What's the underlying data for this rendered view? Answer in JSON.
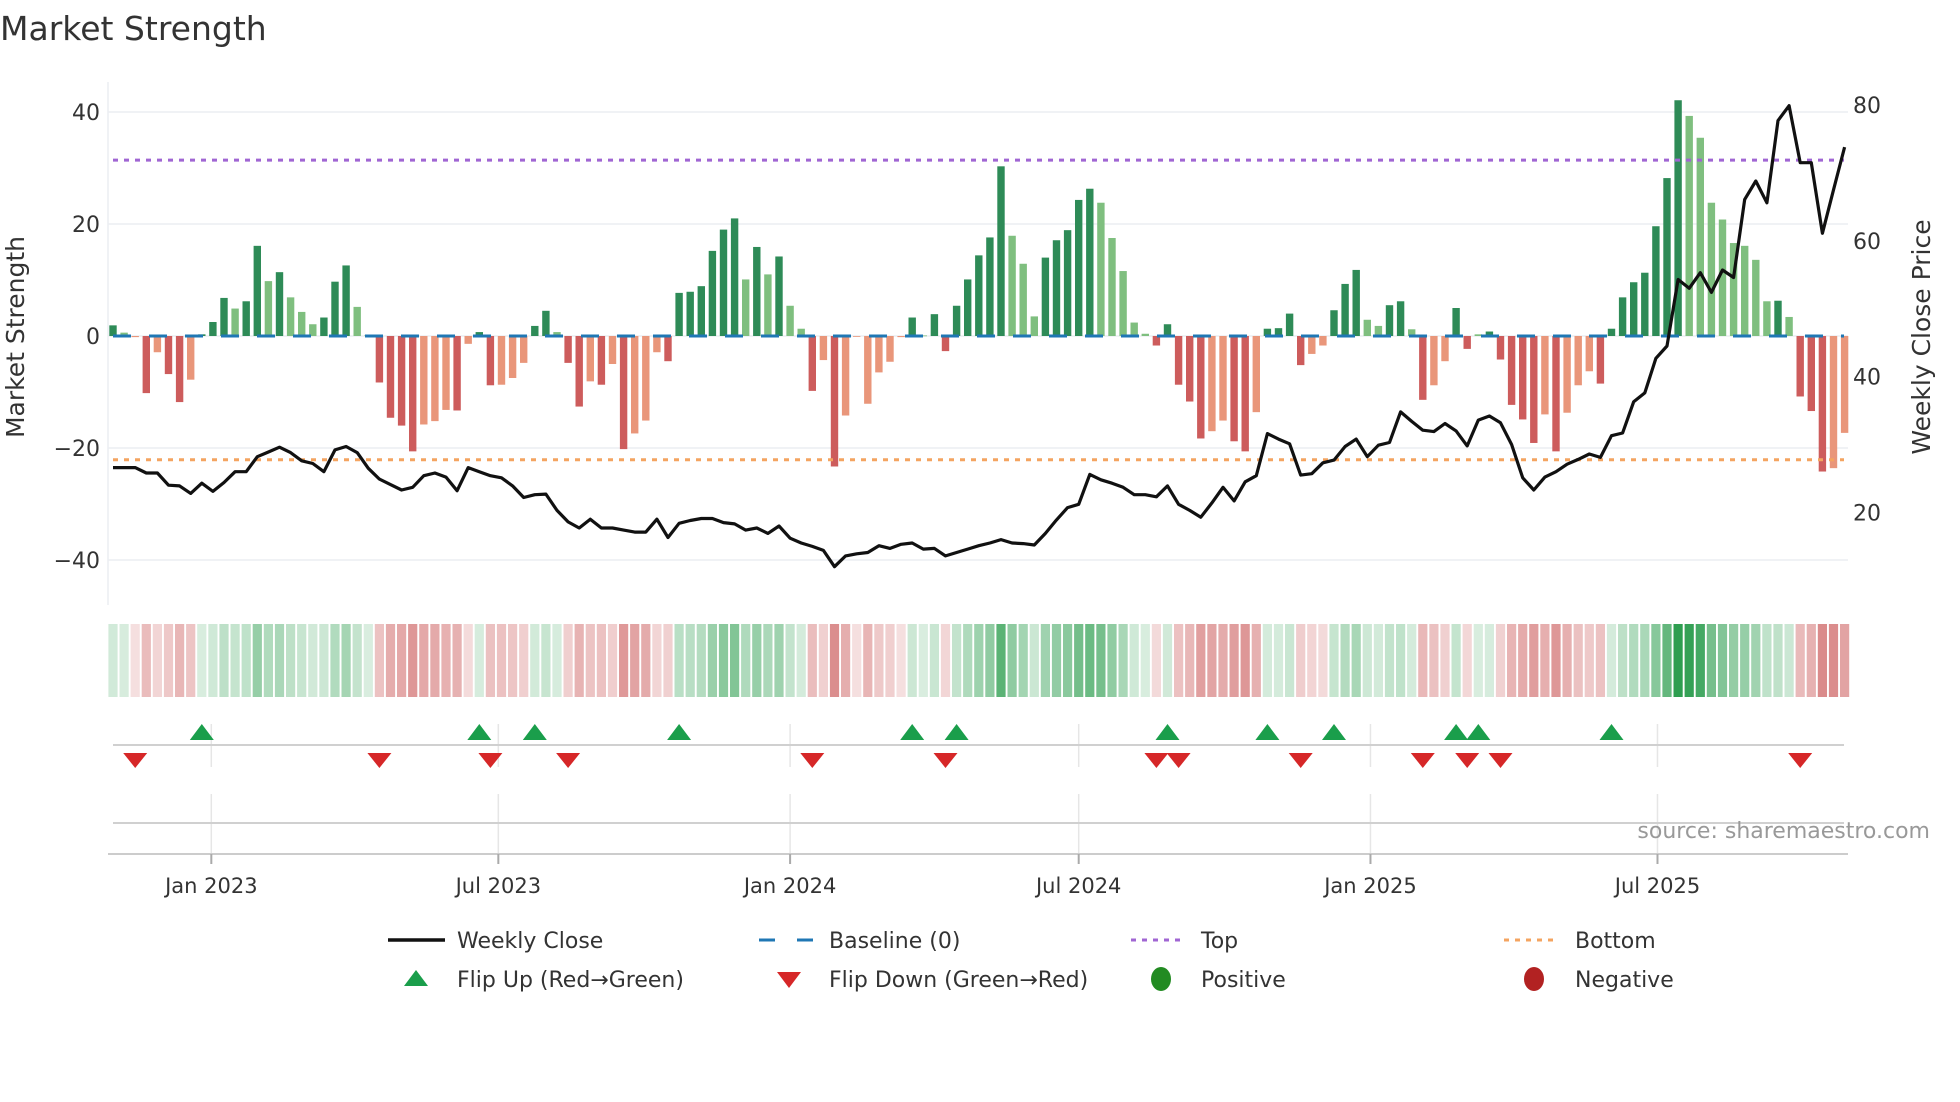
{
  "title": "Market Strength",
  "source": "source: sharemaestro.com",
  "colors": {
    "strong_green": "#2e8b57",
    "weak_green": "#7fbf7f",
    "strong_red": "#cd5c5c",
    "weak_red": "#e9967a",
    "baseline": "#1f77b4",
    "top": "#a066d3",
    "bottom": "#f4a460",
    "close": "#111111",
    "flip_up": "#1a9e4b",
    "flip_down": "#d62728",
    "positive": "#228b22",
    "negative": "#b22222",
    "heat_green": "#2e9e50",
    "heat_red": "#c85050"
  },
  "legend": {
    "weekly_close": "Weekly Close",
    "baseline": "Baseline (0)",
    "top": "Top",
    "bottom": "Bottom",
    "flip_up": "Flip Up (Red→Green)",
    "flip_down": "Flip Down (Green→Red)",
    "positive": "Positive",
    "negative": "Negative"
  },
  "chart_data": {
    "type": "bar",
    "title": "Market Strength",
    "ylabel": "Market Strength",
    "y2label": "Weekly Close Price",
    "ylim": [
      -48,
      45.4
    ],
    "y2lim": [
      6.3,
      83.4
    ],
    "yticks": [
      40,
      20,
      0,
      -20,
      -40
    ],
    "ytick_labels": [
      "40",
      "20",
      "0",
      "−20",
      "−40"
    ],
    "y2ticks": [
      80,
      60,
      40,
      20
    ],
    "y2tick_labels": [
      "80",
      "60",
      "40",
      "20"
    ],
    "top_level": 31.4,
    "bottom_level": -22.1,
    "baseline_level": 0,
    "start_date": "2022-10-31",
    "frequency_days": 7,
    "xticks": [
      {
        "date": "2023-01-01",
        "label": "Jan 2023"
      },
      {
        "date": "2023-07-01",
        "label": "Jul 2023"
      },
      {
        "date": "2024-01-01",
        "label": "Jan 2024"
      },
      {
        "date": "2024-07-01",
        "label": "Jul 2024"
      },
      {
        "date": "2025-01-01",
        "label": "Jan 2025"
      },
      {
        "date": "2025-07-01",
        "label": "Jul 2025"
      }
    ],
    "strength": [
      1.9,
      0.6,
      -0.2,
      -10.2,
      -2.9,
      -6.8,
      -11.8,
      -7.8,
      0.3,
      2.5,
      6.8,
      4.9,
      6.2,
      16.1,
      9.8,
      11.4,
      6.9,
      4.3,
      2.1,
      3.3,
      9.7,
      12.6,
      5.2,
      0.2,
      -8.3,
      -14.6,
      -16.0,
      -20.6,
      -15.8,
      -15.2,
      -13.2,
      -13.3,
      -1.4,
      0.7,
      -8.8,
      -8.7,
      -7.5,
      -4.8,
      1.8,
      4.5,
      0.7,
      -4.8,
      -12.6,
      -8.1,
      -8.7,
      -5.0,
      -20.2,
      -17.4,
      -15.1,
      -2.9,
      -4.5,
      7.7,
      7.9,
      8.9,
      15.2,
      19.0,
      21.0,
      10.1,
      15.9,
      11.0,
      14.2,
      5.4,
      1.3,
      -9.8,
      -4.3,
      -23.3,
      -14.2,
      -0.1,
      -12.1,
      -6.5,
      -4.6,
      -0.2,
      3.3,
      0.1,
      3.9,
      -2.7,
      5.4,
      10.1,
      14.4,
      17.6,
      30.3,
      17.9,
      12.9,
      3.5,
      14.0,
      17.1,
      18.9,
      24.3,
      26.3,
      23.8,
      17.5,
      11.6,
      2.4,
      0.4,
      -1.7,
      2.1,
      -8.7,
      -11.7,
      -18.3,
      -17.0,
      -15.1,
      -18.8,
      -20.6,
      -13.6,
      1.3,
      1.4,
      4.0,
      -5.2,
      -3.2,
      -1.7,
      4.6,
      9.3,
      11.8,
      2.9,
      1.8,
      5.5,
      6.2,
      1.2,
      -11.4,
      -8.8,
      -4.5,
      5.0,
      -2.3,
      0.3,
      0.8,
      -4.2,
      -12.3,
      -14.9,
      -19.1,
      -14.0,
      -20.6,
      -13.7,
      -8.8,
      -6.3,
      -8.5,
      1.3,
      6.9,
      9.6,
      11.3,
      19.6,
      28.2,
      42.1,
      39.3,
      35.4,
      23.8,
      20.8,
      16.6,
      16.1,
      13.6,
      6.2,
      6.3,
      3.4,
      -10.8,
      -13.4,
      -24.2,
      -23.6,
      -17.3
    ],
    "state": "GgrRrRRrGGGgGGgGgggGGGggRRRRrrrRrGRrrrGGgRRrRrRrrrRGGGGGGgGgGggRrRrrrrrrGgGRGGGGGgggGGGGGgggggRGRRRrrRRrGGGRrrGGGggGGgRrrGRgGRRRRrRrrrRGGGGGGGggggggggGgRRRrr",
    "weekly_close": [
      26.6,
      26.6,
      26.6,
      25.8,
      25.8,
      24.0,
      23.9,
      22.8,
      24.3,
      23.1,
      24.4,
      26.0,
      26.0,
      28.2,
      28.9,
      29.6,
      28.8,
      27.6,
      27.2,
      26.0,
      29.2,
      29.7,
      28.8,
      26.5,
      24.9,
      24.1,
      23.3,
      23.7,
      25.4,
      25.8,
      25.2,
      23.2,
      26.6,
      26.0,
      25.4,
      25.1,
      23.9,
      22.2,
      22.6,
      22.7,
      20.3,
      18.6,
      17.7,
      19.0,
      17.7,
      17.7,
      17.4,
      17.1,
      17.1,
      19.0,
      16.3,
      18.4,
      18.8,
      19.1,
      19.1,
      18.5,
      18.3,
      17.4,
      17.7,
      16.9,
      18.0,
      16.2,
      15.5,
      15.0,
      14.4,
      12.0,
      13.6,
      13.9,
      14.1,
      15.1,
      14.7,
      15.3,
      15.5,
      14.6,
      14.7,
      13.6,
      14.1,
      14.6,
      15.1,
      15.5,
      16.0,
      15.5,
      15.4,
      15.2,
      16.9,
      18.9,
      20.7,
      21.2,
      25.6,
      24.8,
      24.3,
      23.7,
      22.6,
      22.6,
      22.3,
      23.9,
      21.2,
      20.3,
      19.3,
      21.4,
      23.7,
      21.7,
      24.5,
      25.4,
      31.6,
      30.8,
      30.1,
      25.5,
      25.7,
      27.3,
      27.7,
      29.7,
      30.8,
      28.2,
      29.9,
      30.3,
      34.8,
      33.4,
      32.1,
      31.9,
      33.1,
      32.0,
      29.8,
      33.6,
      34.2,
      33.2,
      30.0,
      25.1,
      23.3,
      25.2,
      26.0,
      27.1,
      27.8,
      28.6,
      28.1,
      31.3,
      31.7,
      36.3,
      37.6,
      42.7,
      44.5,
      54.3,
      53.0,
      55.3,
      52.4,
      55.7,
      54.6,
      66.1,
      68.8,
      65.6,
      77.7,
      79.9,
      71.5,
      71.5,
      61.1,
      67.5,
      73.8
    ],
    "flip_up_weeks": [
      8,
      33,
      38,
      51,
      72,
      76,
      95,
      104,
      110,
      121,
      123,
      135
    ],
    "flip_down_weeks": [
      2,
      24,
      34,
      41,
      63,
      75,
      94,
      96,
      107,
      118,
      122,
      125,
      152
    ],
    "legend_placement": "bottom"
  }
}
